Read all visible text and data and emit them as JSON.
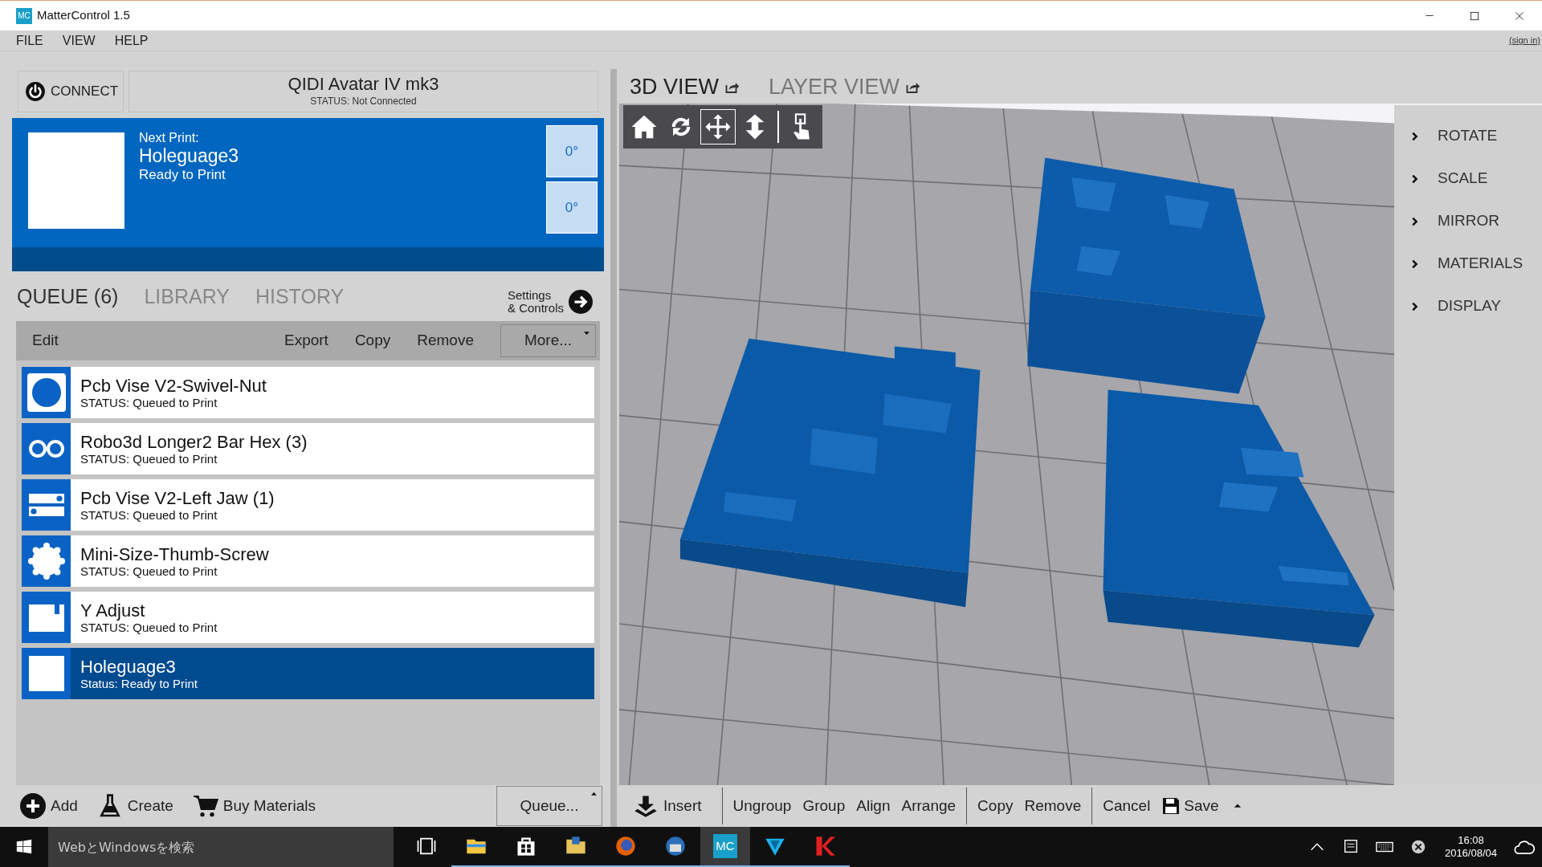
{
  "window": {
    "title": "MatterControl 1.5",
    "logo": "MC"
  },
  "menu": [
    {
      "label": "FILE"
    },
    {
      "label": "VIEW"
    },
    {
      "label": "HELP"
    }
  ],
  "sign_in": "(sign in)",
  "printer": {
    "connect": "CONNECT",
    "name": "QIDI Avatar IV mk3",
    "status": "STATUS: Not Connected"
  },
  "next_print": {
    "label": "Next Print:",
    "name": "Holeguage3",
    "status": "Ready to Print",
    "temperatures": [
      "0°",
      "0°"
    ]
  },
  "tabs": [
    {
      "label": "QUEUE (6)",
      "selected": true
    },
    {
      "label": "LIBRARY",
      "selected": false
    },
    {
      "label": "HISTORY",
      "selected": false
    }
  ],
  "settings_button": [
    "Settings",
    "& Controls"
  ],
  "queue_toolbar": {
    "edit": "Edit",
    "actions": [
      "Export",
      "Copy",
      "Remove"
    ],
    "more": "More..."
  },
  "queue_items": [
    {
      "name": "Pcb Vise V2-Swivel-Nut",
      "status": "STATUS: Queued to Print",
      "kind": "disc",
      "selected": false
    },
    {
      "name": "Robo3d Longer2 Bar Hex (3)",
      "status": "STATUS: Queued to Print",
      "kind": "rings",
      "selected": false
    },
    {
      "name": "Pcb Vise V2-Left Jaw (1)",
      "status": "STATUS: Queued to Print",
      "kind": "bars",
      "selected": false
    },
    {
      "name": "Mini-Size-Thumb-Screw",
      "status": "STATUS: Queued to Print",
      "kind": "gear",
      "selected": false
    },
    {
      "name": "Y Adjust",
      "status": "STATUS: Queued to Print",
      "kind": "notch",
      "selected": false
    },
    {
      "name": "Holeguage3",
      "status": "Status: Ready to Print",
      "kind": "blank",
      "selected": true
    }
  ],
  "bottom_actions": [
    {
      "label": "Add",
      "kind": "add"
    },
    {
      "label": "Create",
      "kind": "create"
    },
    {
      "label": "Buy Materials",
      "kind": "cart"
    }
  ],
  "queue_button": "Queue...",
  "view_tabs": [
    {
      "label": "3D VIEW",
      "selected": true
    },
    {
      "label": "LAYER VIEW",
      "selected": false
    }
  ],
  "view_tools": [
    {
      "kind": "home",
      "selected": false
    },
    {
      "kind": "rotate",
      "selected": false
    },
    {
      "kind": "move",
      "selected": true
    },
    {
      "kind": "lift",
      "selected": false
    },
    {
      "kind": "touch",
      "selected": false
    }
  ],
  "side_menu": [
    {
      "label": "ROTATE"
    },
    {
      "label": "SCALE"
    },
    {
      "label": "MIRROR"
    },
    {
      "label": "MATERIALS"
    },
    {
      "label": "DISPLAY"
    }
  ],
  "edit_toolbar": [
    [
      {
        "label": "Insert",
        "kind": "insert"
      }
    ],
    [
      {
        "label": "Ungroup",
        "kind": "text"
      },
      {
        "label": "Group",
        "kind": "text"
      },
      {
        "label": "Align",
        "kind": "text"
      },
      {
        "label": "Arrange",
        "kind": "text"
      }
    ],
    [
      {
        "label": "Copy",
        "kind": "text"
      },
      {
        "label": "Remove",
        "kind": "text"
      }
    ],
    [
      {
        "label": "Cancel",
        "kind": "text"
      },
      {
        "label": "Save",
        "kind": "save"
      }
    ]
  ],
  "taskbar": {
    "search_placeholder": "WebとWindowsを検索",
    "apps": [
      {
        "kind": "taskview",
        "selected": false
      },
      {
        "kind": "explorer",
        "selected": false
      },
      {
        "kind": "store",
        "selected": false
      },
      {
        "kind": "folder",
        "selected": false
      },
      {
        "kind": "firefox",
        "selected": false
      },
      {
        "kind": "mail",
        "selected": false
      },
      {
        "kind": "mattercontrol",
        "label": "MC",
        "selected": true
      },
      {
        "kind": "vpn",
        "selected": false
      },
      {
        "kind": "k",
        "selected": false
      }
    ],
    "time": "16:08",
    "date": "2016/08/04"
  }
}
